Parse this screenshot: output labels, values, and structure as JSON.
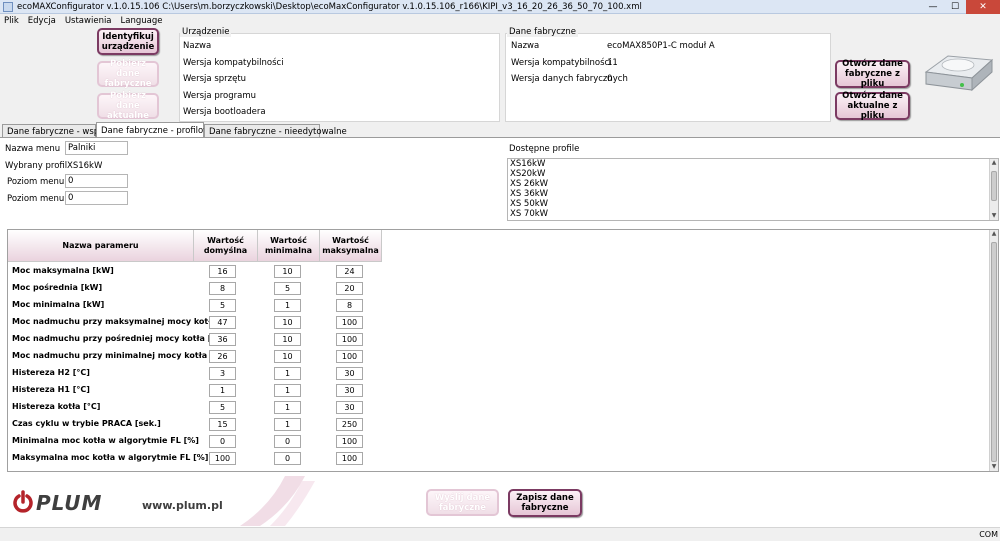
{
  "window": {
    "title": "ecoMAXConfigurator v.1.0.15.106 C:\\Users\\m.borzyczkowski\\Desktop\\ecoMaxConfigurator v.1.0.15.106_r166\\KIPI_v3_16_20_26_36_50_70_100.xml",
    "minimize": "—",
    "maximize": "☐",
    "close": "✕"
  },
  "menu": [
    "Plik",
    "Edycja",
    "Ustawienia",
    "Language"
  ],
  "actions": {
    "identify": "Identyfikuj urządzenie",
    "get_factory": "Pobierz dane fabryczne",
    "get_current": "Pobierz dane aktualne",
    "open_factory": "Otwórz dane fabryczne z pliku",
    "open_current": "Otwórz dane aktualne z pliku"
  },
  "device": {
    "title": "Urządzenie",
    "fields": [
      "Nazwa",
      "Wersja kompatybilności",
      "Wersja sprzętu",
      "Wersja programu",
      "Wersja bootloadera"
    ]
  },
  "factory": {
    "title": "Dane fabryczne",
    "fields": [
      {
        "label": "Nazwa",
        "value": "ecoMAX850P1-C moduł A"
      },
      {
        "label": "Wersja kompatybilności",
        "value": "11"
      },
      {
        "label": "Wersja danych fabrycznych",
        "value": "0"
      }
    ]
  },
  "tabs": [
    "Dane fabryczne - wspólne",
    "Dane fabryczne - profilowane",
    "Dane fabryczne - nieedytowalne"
  ],
  "form": {
    "menu_name_label": "Nazwa menu",
    "menu_name_value": "Palniki",
    "profile_label": "Wybrany profil",
    "profile_value": "XS16kW",
    "level0_label": "Poziom menu 0",
    "level0_value": "0",
    "level1_label": "Poziom menu 1",
    "level1_value": "0"
  },
  "profiles": {
    "label": "Dostępne profile",
    "items": [
      "XS16kW",
      "XS20kW",
      "XS 26kW",
      "XS 36kW",
      "XS 50kW",
      "XS 70kW"
    ]
  },
  "table": {
    "headers": [
      "Nazwa paramеru",
      "Wartość domyślna",
      "Wartość minimalna",
      "Wartość maksymalna"
    ],
    "rows": [
      {
        "name": "Moc maksymalna [kW]",
        "def": "16",
        "min": "10",
        "max": "24"
      },
      {
        "name": "Moc pośrednia [kW]",
        "def": "8",
        "min": "5",
        "max": "20"
      },
      {
        "name": "Moc minimalna [kW]",
        "def": "5",
        "min": "1",
        "max": "8"
      },
      {
        "name": "Moc nadmuchu przy maksymalnej mocy kotła [%]",
        "def": "47",
        "min": "10",
        "max": "100"
      },
      {
        "name": "Moc nadmuchu przy pośredniej mocy kotła [%]",
        "def": "36",
        "min": "10",
        "max": "100"
      },
      {
        "name": "Moc nadmuchu przy minimalnej mocy kotła [%]",
        "def": "26",
        "min": "10",
        "max": "100"
      },
      {
        "name": "Histereza H2 [°C]",
        "def": "3",
        "min": "1",
        "max": "30"
      },
      {
        "name": "Histereza H1 [°C]",
        "def": "1",
        "min": "1",
        "max": "30"
      },
      {
        "name": "Histereza kotła [°C]",
        "def": "5",
        "min": "1",
        "max": "30"
      },
      {
        "name": "Czas cyklu w trybie PRACA [sek.]",
        "def": "15",
        "min": "1",
        "max": "250"
      },
      {
        "name": "Minimalna moc kotła w algorytmie FL [%]",
        "def": "0",
        "min": "0",
        "max": "100"
      },
      {
        "name": "Maksymalna moc kotła w algorytmie FL [%]",
        "def": "100",
        "min": "0",
        "max": "100"
      }
    ]
  },
  "footer": {
    "logo": "PLUM",
    "url": "www.plum.pl",
    "send": "Wyślij dane fabryczne",
    "save": "Zapisz dane fabryczne"
  },
  "status": "COM"
}
